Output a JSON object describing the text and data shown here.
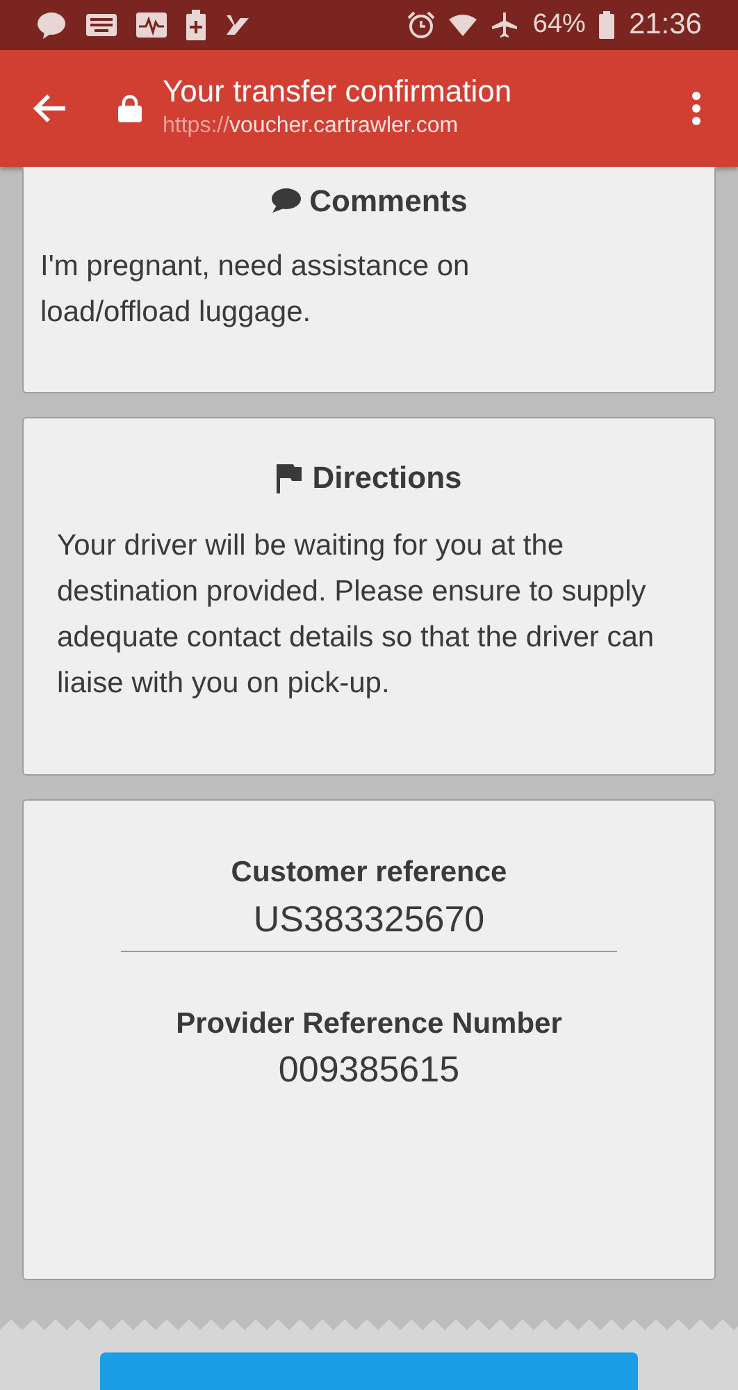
{
  "status_bar": {
    "battery": "64%",
    "time": "21:36"
  },
  "toolbar": {
    "title": "Your transfer confirmation",
    "url_scheme": "https://",
    "url_host": "voucher.cartrawler.com"
  },
  "comments": {
    "title": "Comments",
    "text": "I'm pregnant, need assistance on load/offload luggage."
  },
  "directions": {
    "title": "Directions",
    "text": "Your driver will be waiting for you at the destination provided. Please ensure to supply adequate contact details so that the driver can liaise with you on pick-up."
  },
  "references": [
    {
      "label": "Customer reference",
      "value": "US383325670"
    },
    {
      "label": "Provider Reference Number",
      "value": "009385615"
    }
  ]
}
